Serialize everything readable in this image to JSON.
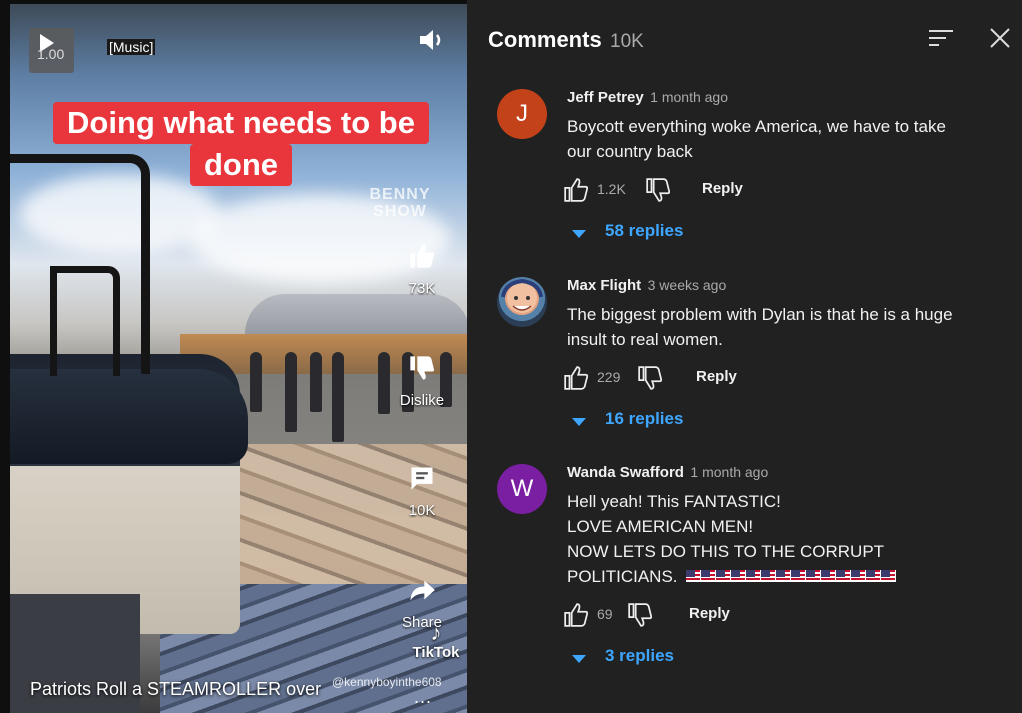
{
  "video": {
    "speed": "1.00",
    "music_tag": "[Music]",
    "caption_lines": [
      "Doing what needs to be",
      "done"
    ],
    "watermark": [
      "BENNY",
      "SHOW"
    ],
    "like_count": "73K",
    "dislike_label": "Dislike",
    "comment_count": "10K",
    "share_label": "Share",
    "tiktok_label": "TikTok",
    "tiktok_user": "@kennyboyinthe608",
    "title": "Patriots Roll a STEAMROLLER over",
    "more": "..."
  },
  "comments_panel": {
    "title": "Comments",
    "count": "10K",
    "comments": [
      {
        "author": "Jeff Petrey",
        "time": "1 month ago",
        "avatar_letter": "J",
        "avatar_color": "#c4421a",
        "lines": [
          "Boycott everything woke America, we have to take",
          "our country back"
        ],
        "likes": "1.2K",
        "reply_label": "Reply",
        "replies": "58 replies"
      },
      {
        "author": "Max Flight",
        "time": "3 weeks ago",
        "avatar_letter": "",
        "avatar_color": "#6b8aa8",
        "lines": [
          "The biggest problem with Dylan is that he is a huge",
          "insult to real women."
        ],
        "likes": "229",
        "reply_label": "Reply",
        "replies": "16 replies"
      },
      {
        "author": "Wanda Swafford",
        "time": "1 month ago",
        "avatar_letter": "W",
        "avatar_color": "#7b1fa2",
        "lines": [
          "Hell yeah! This FANTASTIC!",
          "LOVE AMERICAN MEN!",
          "NOW LETS DO THIS TO THE CORRUPT",
          "POLITICIANS."
        ],
        "likes": "69",
        "reply_label": "Reply",
        "replies": "3 replies"
      }
    ]
  },
  "colors": {
    "accent_blue": "#3ea6ff",
    "panel_bg": "#212121",
    "caption_red": "#e8363c"
  },
  "icons": [
    "play-icon",
    "volume-icon",
    "thumbs-up-icon",
    "thumbs-down-icon",
    "comment-icon",
    "share-icon",
    "sort-icon",
    "close-icon",
    "chevron-down-icon",
    "us-flag-icon"
  ]
}
